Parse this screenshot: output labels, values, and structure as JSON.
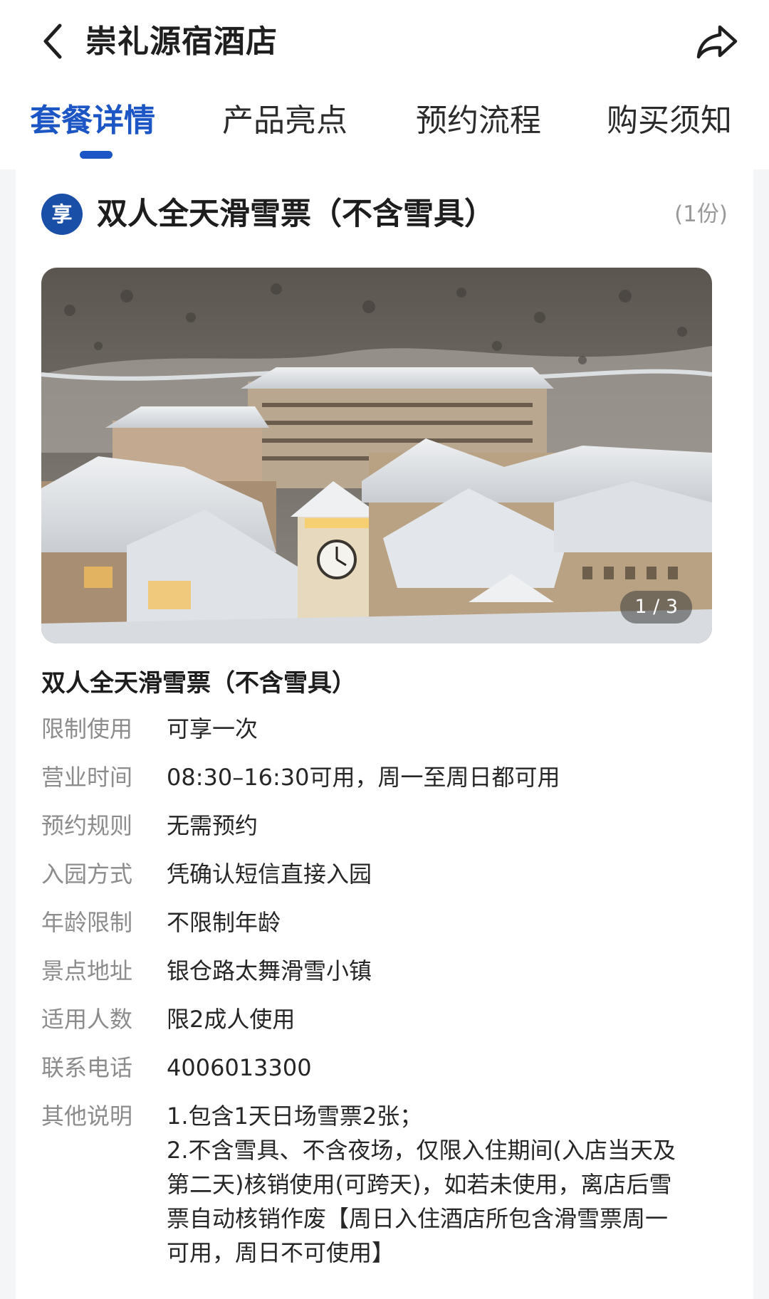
{
  "header": {
    "title": "崇礼源宿酒店",
    "back_icon": "chevron-left-icon",
    "share_icon": "share-arrow-icon"
  },
  "tabs": [
    {
      "label": "套餐详情",
      "active": true
    },
    {
      "label": "产品亮点",
      "active": false
    },
    {
      "label": "预约流程",
      "active": false
    },
    {
      "label": "购买须知",
      "active": false
    }
  ],
  "package": {
    "badge": "享",
    "title": "双人全天滑雪票（不含雪具）",
    "quantity": "(1份)",
    "image_counter": "1 / 3",
    "subtitle": "双人全天滑雪票（不含雪具）",
    "details": [
      {
        "key": "限制使用",
        "value": "可享一次"
      },
      {
        "key": "营业时间",
        "value": "08:30–16:30可用，周一至周日都可用"
      },
      {
        "key": "预约规则",
        "value": "无需预约"
      },
      {
        "key": "入园方式",
        "value": "凭确认短信直接入园"
      },
      {
        "key": "年龄限制",
        "value": "不限制年龄"
      },
      {
        "key": "景点地址",
        "value": "银仓路太舞滑雪小镇"
      },
      {
        "key": "适用人数",
        "value": "限2成人使用"
      },
      {
        "key": "联系电话",
        "value": "4006013300"
      }
    ],
    "notes": {
      "key": "其他说明",
      "lines": [
        "1.包含1天日场雪票2张；",
        "2.不含雪具、不含夜场，仅限入住期间(入店当天及",
        "第二天)核销使用(可跨天)，如若未使用，离店后雪",
        "票自动核销作废【周日入住酒店所包含滑雪票周一",
        "可用，周日不可使用】"
      ]
    }
  },
  "colors": {
    "accent": "#1c56c4",
    "badge": "#1a4fa8",
    "label_gray": "#8c8c8c"
  }
}
